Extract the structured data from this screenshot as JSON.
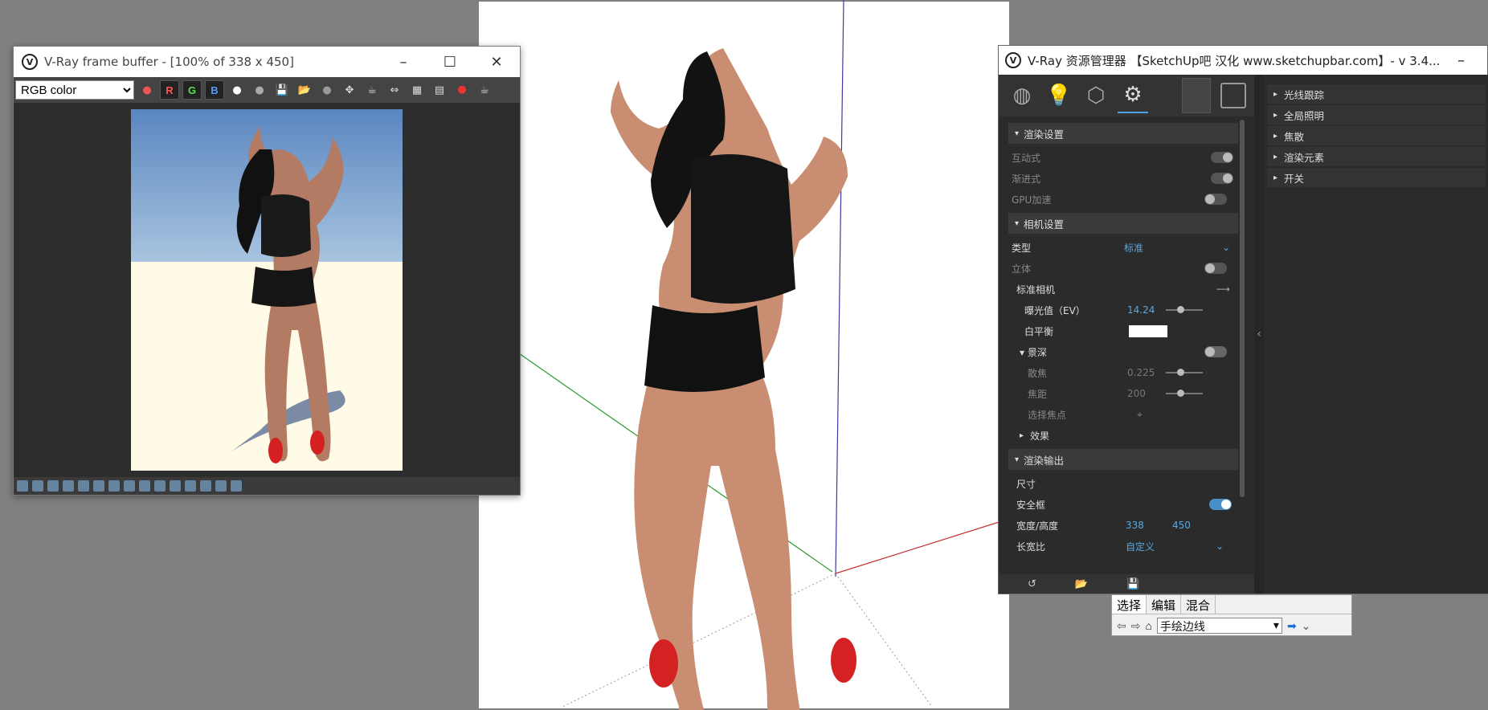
{
  "vfb": {
    "title": "V-Ray frame buffer - [100% of 338 x 450]",
    "channel_select": "RGB color",
    "channels": [
      "R",
      "G",
      "B"
    ]
  },
  "editor": {
    "title": "V-Ray 资源管理器 【SketchUp吧 汉化 www.sketchupbar.com】- v 3.4...",
    "sections": {
      "render_settings": "渲染设置",
      "camera": "相机设置",
      "render_output": "渲染输出"
    },
    "rows": {
      "interactive": "互动式",
      "progressive": "渐进式",
      "gpu": "GPU加速",
      "type_label": "类型",
      "type_value": "标准",
      "stereo": "立体",
      "std_camera": "标准相机",
      "exposure_label": "曝光值（EV）",
      "exposure_value": "14.24",
      "white_balance": "白平衡",
      "dof": "景深",
      "defocus_label": "散焦",
      "defocus_value": "0.225",
      "focus_label": "焦距",
      "focus_value": "200",
      "pick_focus": "选择焦点",
      "effects": "效果",
      "size": "尺寸",
      "safe_frame": "安全框",
      "wh_label": "宽度/高度",
      "width": "338",
      "height": "450",
      "aspect_label": "长宽比",
      "aspect_value": "自定义"
    },
    "right_items": [
      "光线跟踪",
      "全局照明",
      "焦散",
      "渲染元素",
      "开关"
    ]
  },
  "sketchup": {
    "tabs": [
      "选择",
      "编辑",
      "混合"
    ],
    "style": "手绘边线"
  },
  "colors": {
    "accent": "#4fa3e0",
    "panel_bg": "#2b2b2b"
  }
}
